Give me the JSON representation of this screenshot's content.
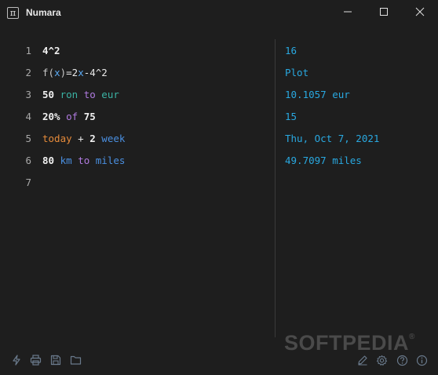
{
  "window": {
    "title": "Numara",
    "app_icon_glyph": "π"
  },
  "lines": [
    {
      "no": "1",
      "result": "16"
    },
    {
      "no": "2",
      "result": "Plot"
    },
    {
      "no": "3",
      "result": "10.1057 eur"
    },
    {
      "no": "4",
      "result": "15"
    },
    {
      "no": "5",
      "result": "Thu, Oct 7, 2021"
    },
    {
      "no": "6",
      "result": "49.7097 miles"
    },
    {
      "no": "7",
      "result": ""
    }
  ],
  "code": {
    "l1": {
      "a": "4^2"
    },
    "l2": {
      "fn": "f(",
      "x1": "x",
      "fn2": ")",
      "op": "=",
      "n": "2",
      "x2": "x",
      "rest": "-4^2"
    },
    "l3": {
      "n": "50",
      "unit1": "ron",
      "kw": "to",
      "unit2": "eur"
    },
    "l4": {
      "pct": "20%",
      "kw": "of",
      "n": "75"
    },
    "l5": {
      "kw1": "today",
      "op": "+",
      "n": "2",
      "unit": "week"
    },
    "l6": {
      "n": "80",
      "unit1": "km",
      "kw": "to",
      "unit2": "miles"
    }
  },
  "toolbar": {
    "left_icons": [
      "lightning-icon",
      "printer-icon",
      "save-icon",
      "folder-icon"
    ],
    "right_icons": [
      "pencil-icon",
      "gear-icon",
      "help-icon",
      "info-icon"
    ]
  },
  "watermark": {
    "text": "SOFTPEDIA",
    "mark": "®"
  },
  "colors": {
    "background": "#1e1e1e",
    "result": "#29a8e0",
    "unit": "#3bb3a4",
    "keyword": "#b07be0",
    "date_keyword": "#e58a3a"
  }
}
